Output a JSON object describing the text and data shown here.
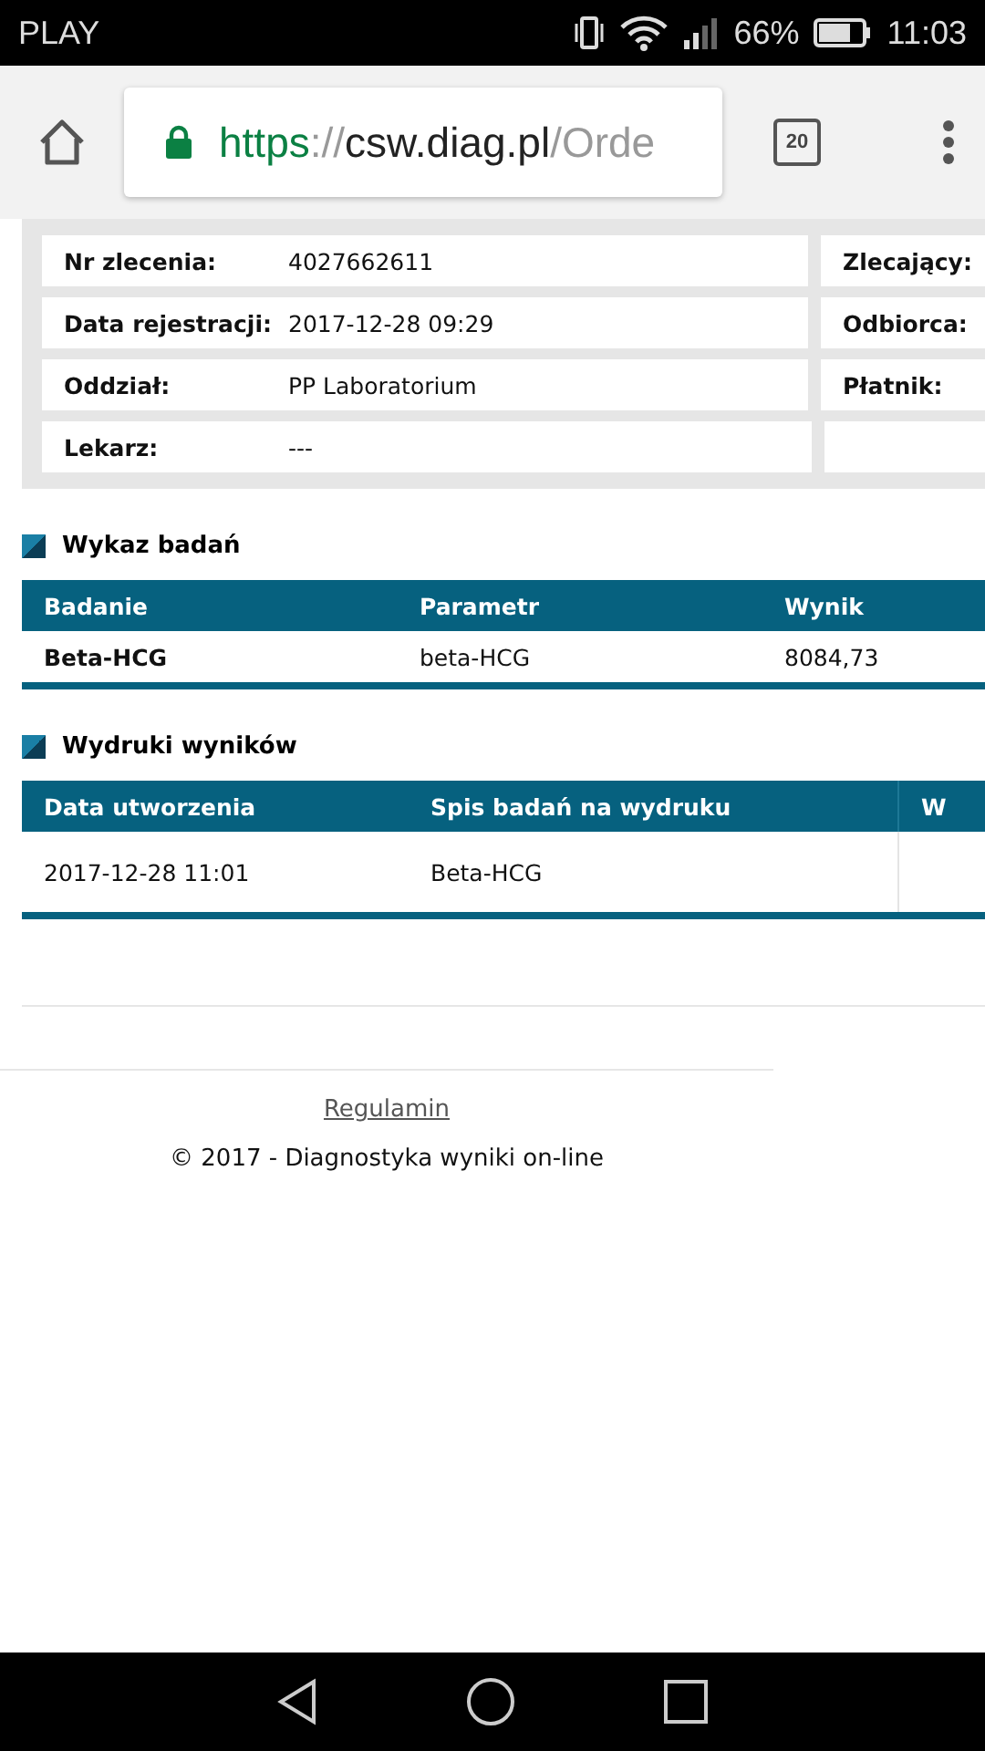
{
  "status_bar": {
    "carrier": "PLAY",
    "battery_text": "66%",
    "time": "11:03"
  },
  "browser": {
    "url": {
      "scheme": "https",
      "separator": "://",
      "host": "csw.diag.pl",
      "path": "/Orde"
    },
    "tab_count": "20"
  },
  "order_info": {
    "rows": [
      {
        "label": "Nr zlecenia:",
        "value": "4027662611",
        "right_label": "Zlecający:"
      },
      {
        "label": "Data rejestracji:",
        "value": "2017-12-28 09:29",
        "right_label": "Odbiorca:"
      },
      {
        "label": "Oddział:",
        "value": "PP Laboratorium",
        "right_label": "Płatnik:"
      },
      {
        "label": "Lekarz:",
        "value": "---"
      }
    ]
  },
  "tests": {
    "title": "Wykaz badań",
    "columns": [
      "Badanie",
      "Parametr",
      "Wynik"
    ],
    "rows": [
      [
        "Beta-HCG",
        "beta-HCG",
        "8084,73"
      ]
    ]
  },
  "printouts": {
    "title": "Wydruki wyników",
    "columns": [
      "Data utworzenia",
      "Spis badań na wydruku",
      "W"
    ],
    "rows": [
      [
        "2017-12-28 11:01",
        "Beta-HCG",
        ""
      ]
    ]
  },
  "footer": {
    "link": "Regulamin",
    "copyright": "© 2017 - Diagnostyka wyniki on-line"
  }
}
